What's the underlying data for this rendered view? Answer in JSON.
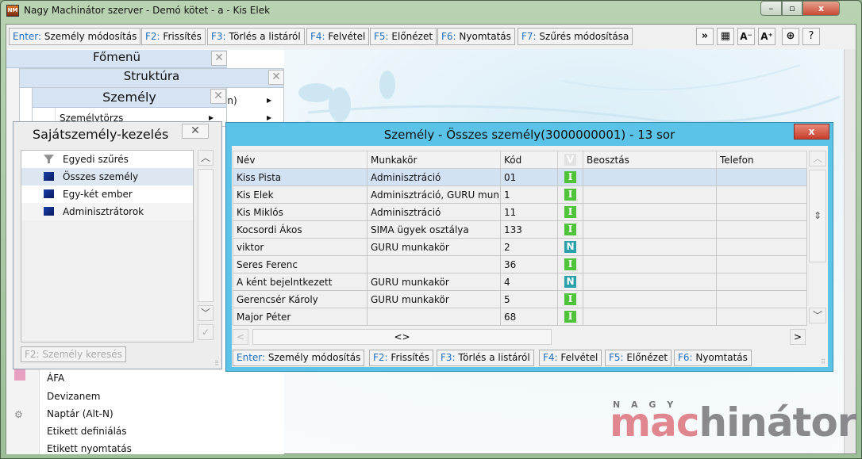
{
  "window": {
    "title": "Nagy Machinátor szerver - Demó kötet - a - Kis Elek",
    "app_icon_text": "NM",
    "minimize": "–",
    "maximize": "▫",
    "close": "x"
  },
  "toolbar": {
    "buttons": [
      {
        "key": "Enter:",
        "label": "Személy módosítás"
      },
      {
        "key": "F2:",
        "label": "Frissítés"
      },
      {
        "key": "F3:",
        "label": "Törlés a listáról"
      },
      {
        "key": "F4:",
        "label": "Felvétel"
      },
      {
        "key": "F5:",
        "label": "Előnézet"
      },
      {
        "key": "F6:",
        "label": "Nyomtatás"
      },
      {
        "key": "F7:",
        "label": "Szűrés módosítása"
      }
    ],
    "icons": {
      "more": "»",
      "layout": "▦",
      "font_smaller": "A⁻",
      "font_larger": "A⁺",
      "navigate": "⊕",
      "help": "?"
    }
  },
  "fomenu": {
    "title": "Főmenü",
    "items": [
      "ÁFA",
      "Devizanem",
      "Naptár (Alt-N)",
      "Etikett definiálás",
      "Etikett nyomtatás"
    ]
  },
  "struktura": {
    "title": "Struktúra",
    "items": [
      "en)",
      ""
    ]
  },
  "szemely_menu": {
    "title": "Személy",
    "items": [
      "Személytörzs"
    ]
  },
  "sajat": {
    "title": "Sajátszemély-kezelés",
    "items": [
      {
        "label": "Egyedi szűrés",
        "icon": "filter-icon"
      },
      {
        "label": "Összes személy",
        "icon": "computer-icon"
      },
      {
        "label": "Egy-két ember",
        "icon": "computer-icon"
      },
      {
        "label": "Adminisztrátorok",
        "icon": "computer-icon"
      }
    ],
    "selected": 1,
    "search_button": "F2: Személy keresés"
  },
  "grid_window": {
    "title": "Személy - Összes személy(3000000001) - 13 sor",
    "columns": [
      "Név",
      "Munkakör",
      "Kód",
      "V",
      "Beosztás",
      "Telefon"
    ],
    "rows": [
      {
        "nev": "Kiss Pista",
        "munkakor": "Adminisztráció",
        "kod": "01",
        "v": "I",
        "beosztas": "",
        "telefon": ""
      },
      {
        "nev": "Kis Elek",
        "munkakor": "Adminisztráció, GURU munkakör",
        "kod": "1",
        "v": "I",
        "beosztas": "",
        "telefon": ""
      },
      {
        "nev": "Kis Miklós",
        "munkakor": "Adminisztráció",
        "kod": "11",
        "v": "I",
        "beosztas": "",
        "telefon": ""
      },
      {
        "nev": "Kocsordi Ákos",
        "munkakor": "SIMA ügyek osztálya",
        "kod": "133",
        "v": "I",
        "beosztas": "",
        "telefon": ""
      },
      {
        "nev": "viktor",
        "munkakor": "GURU munkakör",
        "kod": "2",
        "v": "N",
        "beosztas": "",
        "telefon": ""
      },
      {
        "nev": "Seres Ferenc",
        "munkakor": "",
        "kod": "36",
        "v": "I",
        "beosztas": "",
        "telefon": ""
      },
      {
        "nev": "A ként bejelntkezett",
        "munkakor": "GURU munkakör",
        "kod": "4",
        "v": "N",
        "beosztas": "",
        "telefon": ""
      },
      {
        "nev": "Gerencsér Károly",
        "munkakor": "GURU munkakör",
        "kod": "5",
        "v": "I",
        "beosztas": "",
        "telefon": ""
      },
      {
        "nev": "Major Péter",
        "munkakor": "",
        "kod": "68",
        "v": "I",
        "beosztas": "",
        "telefon": ""
      }
    ],
    "selected_row": 0,
    "badge_colors": {
      "I": "#4fc43a",
      "N": "#2aa1a8"
    },
    "buttons": [
      {
        "key": "Enter:",
        "label": "Személy módosítás"
      },
      {
        "key": "F2:",
        "label": "Frissítés"
      },
      {
        "key": "F3:",
        "label": "Törlés a listáról"
      },
      {
        "key": "F4:",
        "label": "Felvétel"
      },
      {
        "key": "F5:",
        "label": "Előnézet"
      },
      {
        "key": "F6:",
        "label": "Nyomtatás"
      }
    ]
  },
  "logo": {
    "top": "N A G Y",
    "part1": "mac",
    "part2": "hinátor",
    "color1": "#e0868f",
    "color2": "#8a8a8e"
  },
  "colors": {
    "grid_title_bar": "#5cc3e8",
    "close_red": "#d9473a",
    "key_blue": "#1f6fbf"
  }
}
